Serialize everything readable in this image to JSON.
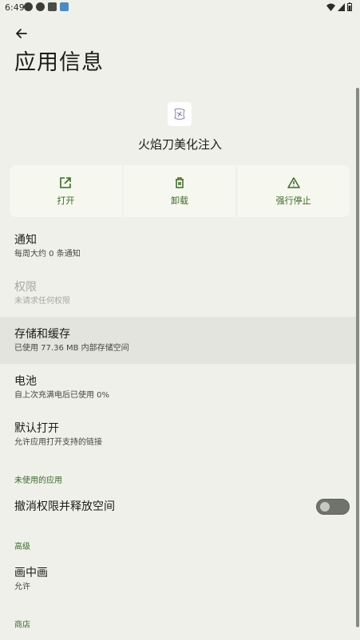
{
  "status_bar": {
    "time": "6:49",
    "left_icons": [
      "telegram-icon",
      "telegram-icon",
      "android-icon",
      "app-notification-icon"
    ],
    "right_icons": [
      "wifi-icon",
      "cellular-icon",
      "battery-icon"
    ]
  },
  "header": {
    "title": "应用信息"
  },
  "app": {
    "name": "火焰刀美化注入"
  },
  "actions": [
    {
      "label": "打开",
      "icon": "open-external-icon"
    },
    {
      "label": "卸载",
      "icon": "trash-icon"
    },
    {
      "label": "强行停止",
      "icon": "warning-icon"
    }
  ],
  "settings": {
    "notifications": {
      "title": "通知",
      "subtitle": "每周大约 0 条通知"
    },
    "permissions": {
      "title": "权限",
      "subtitle": "未请求任何权限"
    },
    "storage": {
      "title": "存储和缓存",
      "subtitle": "已使用 77.36 MB 内部存储空间"
    },
    "battery": {
      "title": "电池",
      "subtitle": "自上次充满电后已使用 0%"
    },
    "open_by_default": {
      "title": "默认打开",
      "subtitle": "允许应用打开支持的链接"
    },
    "unused_section": "未使用的应用",
    "revoke": {
      "title": "撤消权限并释放空间",
      "toggle_on": false
    },
    "advanced_section": "高级",
    "pip": {
      "title": "画中画",
      "subtitle": "允许"
    },
    "store_section": "商店"
  },
  "colors": {
    "background": "#eff0ea",
    "accent": "#3c6a26"
  }
}
